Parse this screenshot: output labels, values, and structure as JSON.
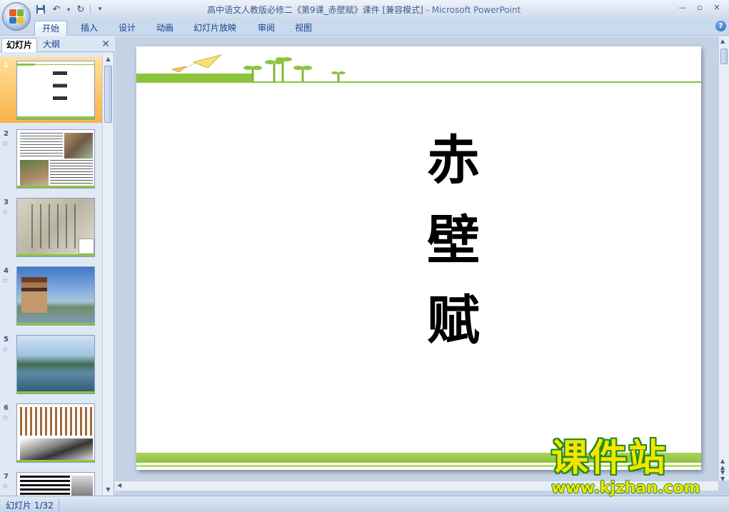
{
  "window": {
    "title": "高中语文人教版必修二《第9课_赤壁赋》课件 [兼容模式]",
    "app_name": " - Microsoft PowerPoint"
  },
  "ribbon": {
    "tabs": [
      {
        "label": "开始",
        "active": true
      },
      {
        "label": "插入"
      },
      {
        "label": "设计"
      },
      {
        "label": "动画"
      },
      {
        "label": "幻灯片放映"
      },
      {
        "label": "审阅"
      },
      {
        "label": "视图"
      }
    ]
  },
  "left_pane": {
    "tabs": [
      "幻灯片",
      "大纲"
    ],
    "slides": [
      {
        "number": "1",
        "selected": true
      },
      {
        "number": "2"
      },
      {
        "number": "3"
      },
      {
        "number": "4"
      },
      {
        "number": "5"
      },
      {
        "number": "6"
      },
      {
        "number": "7"
      }
    ]
  },
  "slide": {
    "title_chars": [
      "赤",
      "壁",
      "赋"
    ]
  },
  "status_bar": {
    "slide_counter": "幻灯片 1/32"
  },
  "watermark": {
    "main": "课件站",
    "url": "www.kjzhan.com"
  },
  "colors": {
    "slide_green": "#8dc43d",
    "selected_thumb": "#f7b24a",
    "watermark_yellow": "#f5e400"
  }
}
